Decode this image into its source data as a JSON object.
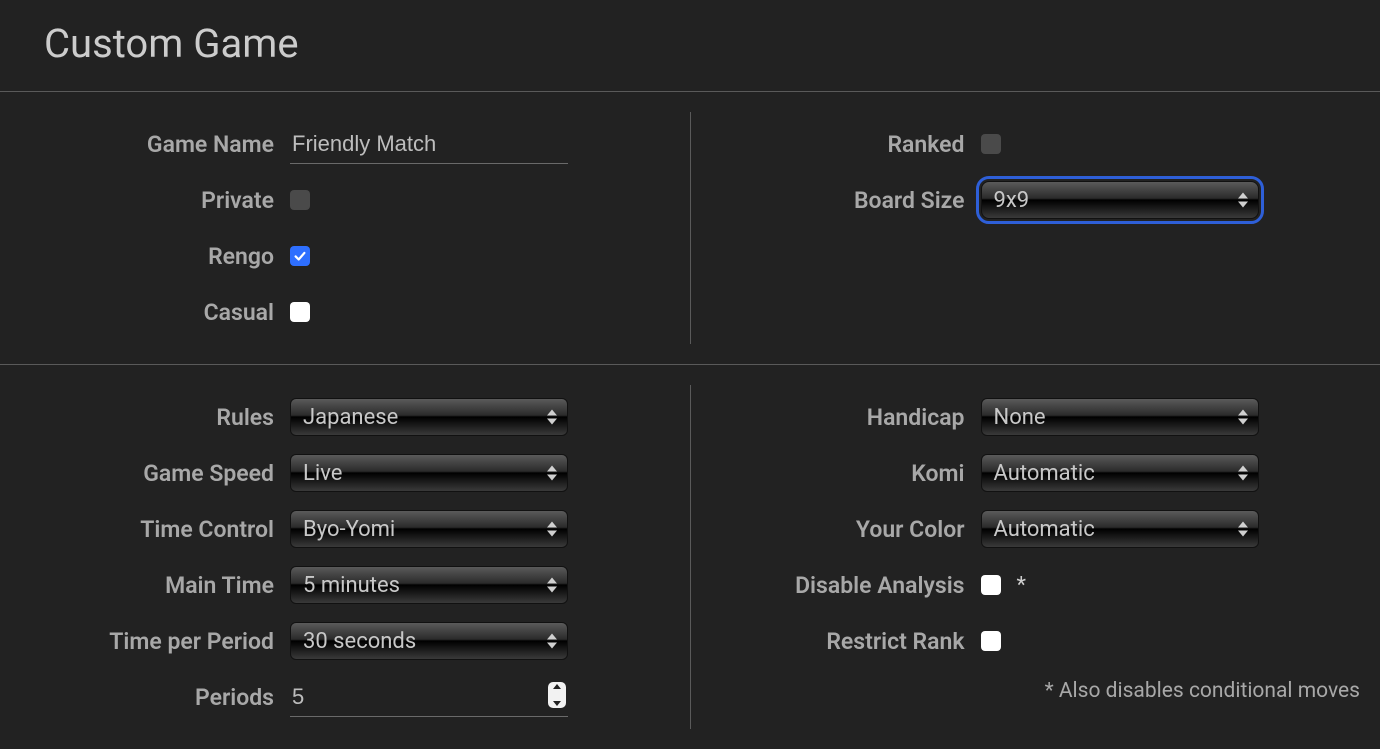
{
  "title": "Custom Game",
  "left1": {
    "game_name_label": "Game Name",
    "game_name_value": "Friendly Match",
    "private_label": "Private",
    "private_checked": false,
    "rengo_label": "Rengo",
    "rengo_checked": true,
    "casual_label": "Casual",
    "casual_checked": false
  },
  "right1": {
    "ranked_label": "Ranked",
    "ranked_checked": false,
    "board_size_label": "Board Size",
    "board_size_value": "9x9"
  },
  "left2": {
    "rules_label": "Rules",
    "rules_value": "Japanese",
    "speed_label": "Game Speed",
    "speed_value": "Live",
    "tc_label": "Time Control",
    "tc_value": "Byo-Yomi",
    "main_time_label": "Main Time",
    "main_time_value": "5 minutes",
    "tpp_label": "Time per Period",
    "tpp_value": "30 seconds",
    "periods_label": "Periods",
    "periods_value": "5"
  },
  "right2": {
    "handicap_label": "Handicap",
    "handicap_value": "None",
    "komi_label": "Komi",
    "komi_value": "Automatic",
    "color_label": "Your Color",
    "color_value": "Automatic",
    "disable_analysis_label": "Disable Analysis",
    "disable_analysis_checked": false,
    "asterisk": "*",
    "restrict_rank_label": "Restrict Rank",
    "restrict_rank_checked": false,
    "footnote": "* Also disables conditional moves"
  }
}
